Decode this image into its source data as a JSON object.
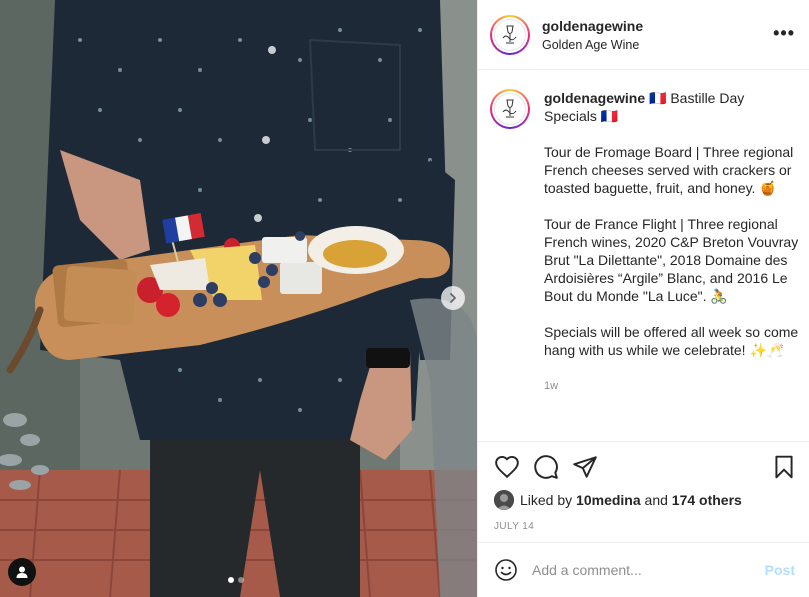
{
  "post": {
    "username": "goldenagewine",
    "display_name": "Golden Age Wine",
    "more_label": "•••",
    "image": {
      "carousel_count": 2,
      "active_index": 0
    }
  },
  "caption": {
    "username": "goldenagewine",
    "title": "🇫🇷 Bastille Day Specials 🇫🇷",
    "paragraphs": [
      "Tour de Fromage Board | Three regional French cheeses served with crackers or toasted baguette, fruit, and honey. 🍯",
      "Tour de France Flight | Three regional French wines, 2020 C&P Breton Vouvray Brut \"La Dilettante\", 2018 Domaine des Ardoisières “Argile” Blanc, and 2016 Le Bout du Monde \"La Luce\". 🚴",
      "Specials will be offered all week so come hang with us while we celebrate! ✨🥂"
    ],
    "time_ago": "1w"
  },
  "likes": {
    "prefix": "Liked by",
    "user": "10medina",
    "and": "and",
    "others": "174 others"
  },
  "date": "JULY 14",
  "comment": {
    "placeholder": "Add a comment...",
    "post_label": "Post"
  },
  "colors": {
    "accent_link": "#0095f6",
    "post_disabled": "#b2dffc",
    "border": "#efefef",
    "muted": "#8e8e8e"
  },
  "icons": {
    "like": "heart-icon",
    "comment": "comment-icon",
    "share": "share-icon",
    "save": "bookmark-icon",
    "emoji": "emoji-icon",
    "next": "chevron-right-icon",
    "tags": "user-tag-icon"
  }
}
